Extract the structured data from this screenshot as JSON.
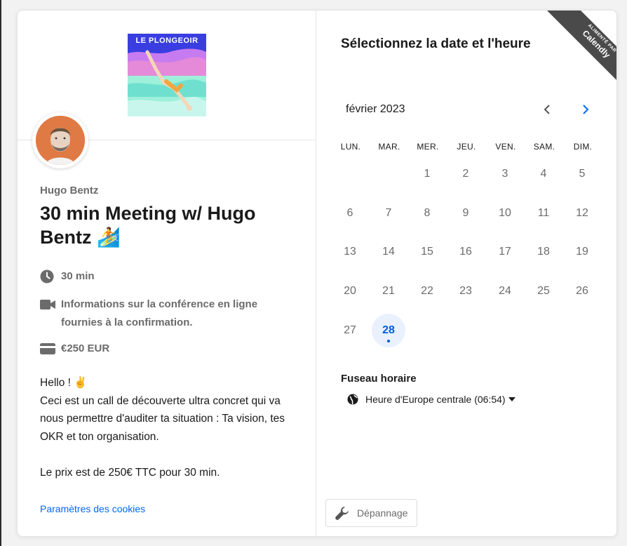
{
  "left": {
    "logo_text": "LE PLONGEOIR",
    "host_name": "Hugo Bentz",
    "event_title": "30 min Meeting w/ Hugo Bentz 🏄",
    "duration": "30 min",
    "conference_info": "Informations sur la conférence en ligne fournies à la confirmation.",
    "price": "€250 EUR",
    "description": [
      "Hello ! ✌️",
      "Ceci est un call de découverte ultra concret qui va nous permettre d'auditer ta situation : Ta vision, tes OKR et ton organisation.",
      "",
      "Le prix est de 250€ TTC pour 30 min."
    ],
    "cookies_link": "Paramètres des cookies",
    "icons": [
      "clock-icon",
      "video-icon",
      "credit-card-icon"
    ]
  },
  "badge": {
    "small": "ALIMENTÉ PAR",
    "brand": "Calendly"
  },
  "right": {
    "title": "Sélectionnez la date et l'heure",
    "month": "février 2023",
    "weekdays": [
      "LUN.",
      "MAR.",
      "MER.",
      "JEU.",
      "VEN.",
      "SAM.",
      "DIM."
    ],
    "weeks": [
      [
        "",
        "",
        "1",
        "2",
        "3",
        "4",
        "5"
      ],
      [
        "6",
        "7",
        "8",
        "9",
        "10",
        "11",
        "12"
      ],
      [
        "13",
        "14",
        "15",
        "16",
        "17",
        "18",
        "19"
      ],
      [
        "20",
        "21",
        "22",
        "23",
        "24",
        "25",
        "26"
      ],
      [
        "27",
        "28",
        "",
        "",
        "",
        "",
        ""
      ]
    ],
    "available_days": [
      "28"
    ],
    "timezone_title": "Fuseau horaire",
    "timezone_value": "Heure d'Europe centrale (06:54)",
    "troubleshoot_label": "Dépannage"
  },
  "colors": {
    "accent": "#0069ff",
    "available_bg": "#e9f1ff",
    "available_text": "#0a5ad1",
    "badge_bg": "#4a4a4a",
    "avatar_bg": "#e07a44"
  }
}
